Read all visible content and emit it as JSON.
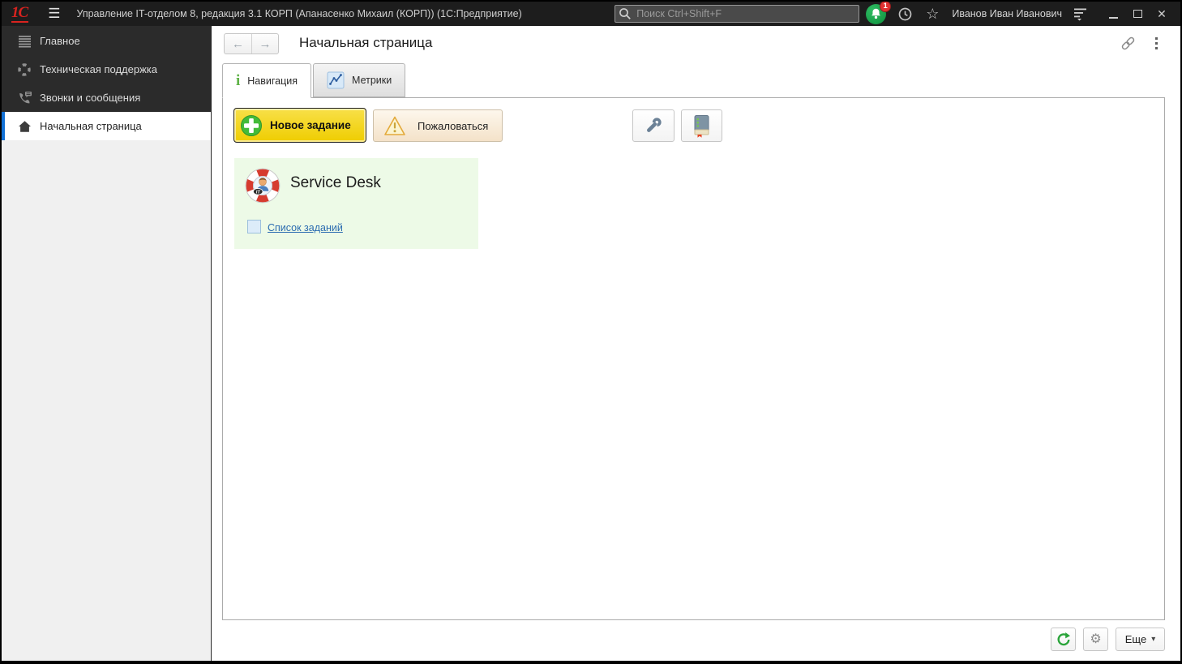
{
  "topbar": {
    "logo_text": "1С",
    "window_title": "Управление IT-отделом 8, редакция 3.1 КОРП (Апанасенко Михаил (КОРП))  (1С:Предприятие)",
    "search_placeholder": "Поиск Ctrl+Shift+F",
    "notification_count": "1",
    "user_name": "Иванов Иван Иванович"
  },
  "sidebar": {
    "items": [
      {
        "label": "Главное"
      },
      {
        "label": "Техническая поддержка"
      },
      {
        "label": "Звонки и сообщения"
      },
      {
        "label": "Начальная страница"
      }
    ]
  },
  "main": {
    "page_title": "Начальная страница",
    "tabs": [
      {
        "label": "Навигация"
      },
      {
        "label": "Метрики"
      }
    ],
    "toolbar": {
      "new_task_label": "Новое задание",
      "complain_label": "Пожаловаться"
    },
    "service_desk": {
      "title": "Service Desk",
      "badge_text": "IT",
      "link_label": "Список заданий"
    },
    "footer": {
      "more_label": "Еще"
    }
  },
  "icons": {
    "hamburger": "☰",
    "star": "☆",
    "close": "✕",
    "back": "←",
    "forward": "→",
    "gear": "⚙",
    "caret_down": "▾",
    "info": "i"
  },
  "colors": {
    "accent_blue": "#1271d6",
    "button_yellow": "#efcd00",
    "success_green": "#43bb39",
    "badge_red": "#e03131",
    "card_green": "#edfae7",
    "link_blue": "#2b6cb0",
    "topbar_dark": "#1d1d1d",
    "sidebar_dark": "#2b2b2b"
  }
}
